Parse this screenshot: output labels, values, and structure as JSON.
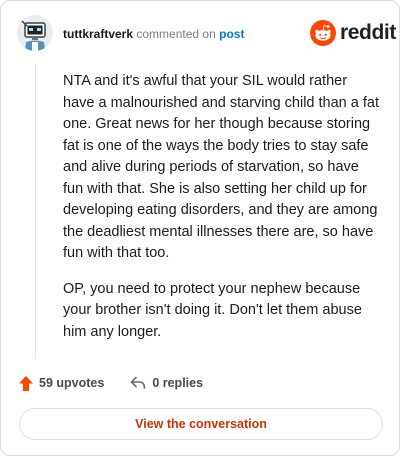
{
  "header": {
    "username": "tuttkraftverk",
    "action_text": "commented on",
    "post_link": "post",
    "brand_name": "reddit"
  },
  "comment": {
    "paragraphs": [
      "NTA and it's awful that your SIL would rather have a malnourished and starving child than a fat one. Great news for her though because storing fat is one of the ways the body tries to stay safe and alive during periods of starvation, so have fun with that. She is also setting her child up for developing eating disorders, and they are among the deadliest mental illnesses there are, so have fun with that too.",
      "OP, you need to protect your nephew because your brother isn't doing it. Don't let them abuse him any longer."
    ]
  },
  "footer": {
    "upvotes_label": "59 upvotes",
    "replies_label": "0 replies",
    "cta_label": "View the conversation"
  },
  "colors": {
    "brand_orange": "#ff4500",
    "link_blue": "#0079d3",
    "cta_text": "#cc3300"
  },
  "icons": {
    "upvote": "upvote-arrow-icon",
    "reply": "reply-arrow-icon",
    "brand": "reddit-snoo-icon",
    "avatar": "robot-avatar"
  }
}
